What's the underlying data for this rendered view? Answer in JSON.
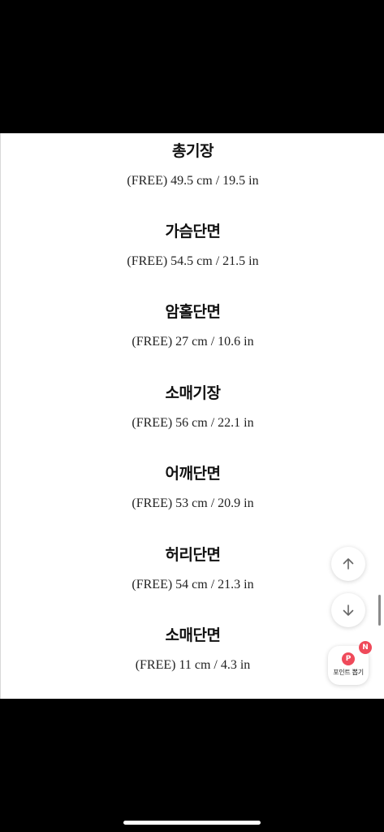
{
  "measurements": [
    {
      "title": "총기장",
      "value": "(FREE) 49.5 cm / 19.5 in"
    },
    {
      "title": "가슴단면",
      "value": "(FREE) 54.5 cm / 21.5 in"
    },
    {
      "title": "암홀단면",
      "value": "(FREE) 27 cm / 10.6 in"
    },
    {
      "title": "소매기장",
      "value": "(FREE) 56 cm / 22.1 in"
    },
    {
      "title": "어깨단면",
      "value": "(FREE) 53 cm / 20.9 in"
    },
    {
      "title": "허리단면",
      "value": "(FREE) 54 cm / 21.3 in"
    },
    {
      "title": "소매단면",
      "value": "(FREE) 11 cm / 4.3 in"
    }
  ],
  "floating": {
    "scroll_up_icon": "arrow-up-icon",
    "scroll_down_icon": "arrow-down-icon",
    "point_icon_letter": "P",
    "point_label": "포인트 뽑기",
    "new_badge": "N",
    "accent_color": "#ef4a5a"
  }
}
